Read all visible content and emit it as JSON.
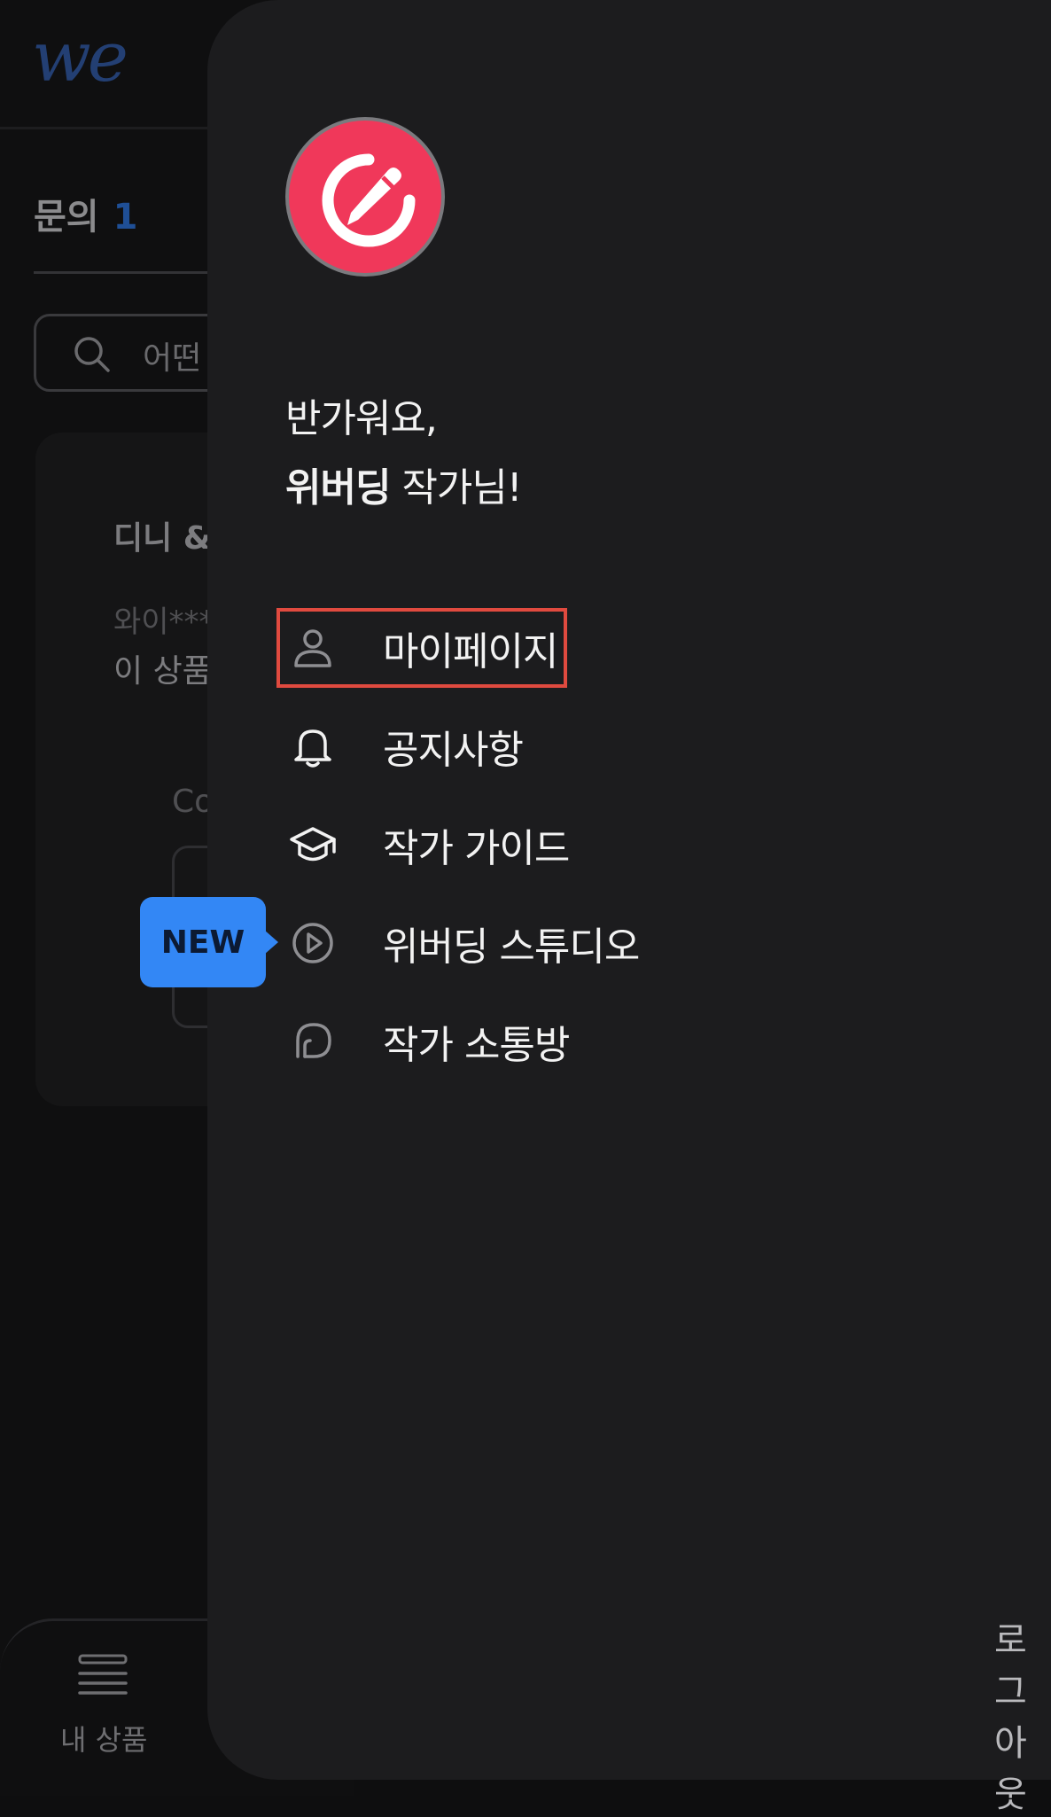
{
  "background": {
    "logo_text": "we",
    "inquiry": {
      "label": "문의",
      "count": "1"
    },
    "search_placeholder": "어떤",
    "card": {
      "title": "디니 &",
      "user": "와이***",
      "text": "이 상품",
      "extra": "Co"
    },
    "tabbar": {
      "my_products_label": "내 상품"
    }
  },
  "drawer": {
    "avatar_icon": "pencil-circle-icon",
    "greeting_line1": "반가워요,",
    "greeting_name": "위버딩",
    "greeting_suffix": " 작가님!",
    "menu": [
      {
        "label": "마이페이지",
        "icon": "person-icon",
        "selected": true
      },
      {
        "label": "공지사항",
        "icon": "bell-icon",
        "selected": false
      },
      {
        "label": "작가 가이드",
        "icon": "graduation-cap-icon",
        "selected": false
      },
      {
        "label": "위버딩 스튜디오",
        "icon": "play-circle-icon",
        "selected": false
      },
      {
        "label": "작가 소통방",
        "icon": "chat-bubble-icon",
        "selected": false
      }
    ],
    "new_badge": "NEW",
    "logout_label": "로그아웃"
  },
  "colors": {
    "accent_red": "#f0385a",
    "badge_blue": "#3387f5",
    "selection_border": "#e04a3f",
    "drawer_bg": "#1c1c1e"
  }
}
